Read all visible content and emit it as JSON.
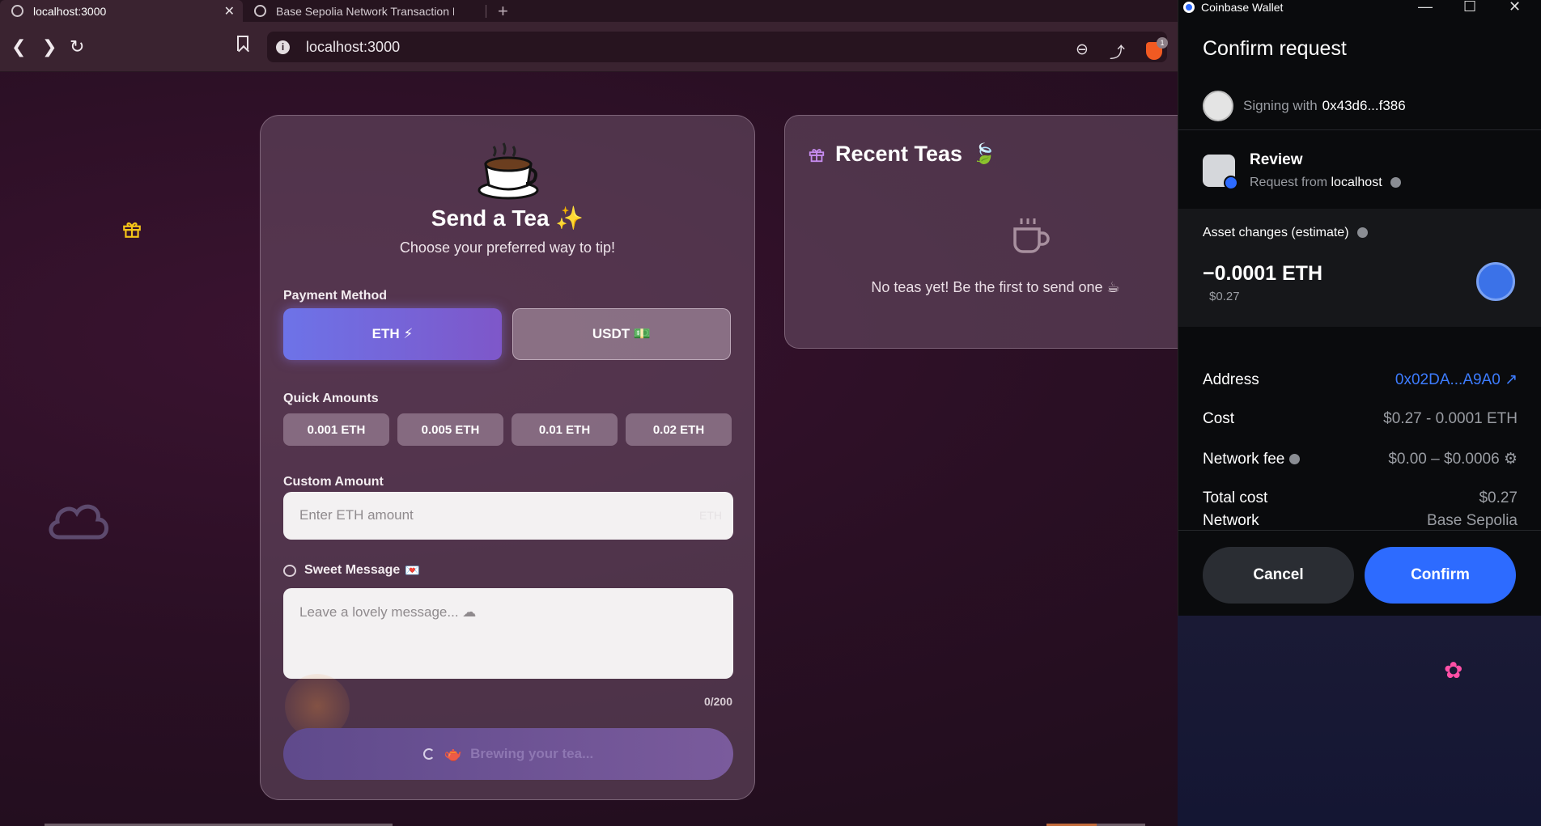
{
  "browser": {
    "tabs": [
      {
        "title": "localhost:3000",
        "close": "✕"
      },
      {
        "title": "Base Sepolia Network Transaction Ha"
      }
    ],
    "new_tab": "+",
    "url": "localhost:3000",
    "shields_count": "1"
  },
  "tea_card": {
    "title": "Send a Tea ✨",
    "subtitle": "Choose your preferred way to tip!",
    "payment_method_label": "Payment Method",
    "payment_options": [
      "ETH ⚡",
      "USDT 💵"
    ],
    "quick_amounts_label": "Quick Amounts",
    "quick_amounts": [
      "0.001 ETH",
      "0.005 ETH",
      "0.01 ETH",
      "0.02 ETH"
    ],
    "custom_amount_label": "Custom Amount",
    "custom_amount_placeholder": "Enter ETH amount",
    "custom_amount_unit": "ETH",
    "message_label": "Sweet Message",
    "message_label_emoji": "💌",
    "message_placeholder": "Leave a lovely message... ☁",
    "char_count": "0/200",
    "submit_label": "Brewing your tea...",
    "submit_emoji": "🫖"
  },
  "recent_card": {
    "title": "Recent Teas",
    "title_emoji": "🍃",
    "empty_text": "No teas yet! Be the first to send one ☕"
  },
  "wallet": {
    "window_title": "Coinbase Wallet",
    "header": "Confirm request",
    "signing_label": "Signing with",
    "signing_address": "0x43d6...f386",
    "review_title": "Review",
    "review_sub_prefix": "Request from",
    "review_origin": "localhost",
    "asset_changes_label": "Asset changes (estimate)",
    "asset_amount": "−0.0001 ETH",
    "asset_usd": "$0.27",
    "details": [
      {
        "key": "Address",
        "value": "0x02DA...A9A0 ↗"
      },
      {
        "key": "Cost",
        "value": "$0.27 - 0.0001 ETH"
      },
      {
        "key": "Network fee",
        "value": "$0.00 – $0.0006 ⚙"
      },
      {
        "key": "Total cost",
        "value": "$0.27"
      },
      {
        "key": "Network",
        "value": "Base Sepolia"
      }
    ],
    "cancel_label": "Cancel",
    "confirm_label": "Confirm"
  },
  "colors": {
    "accent_blue": "#2d6bff",
    "eth_gradient_start": "#6d73e8",
    "eth_gradient_end": "#7e57c9",
    "flower_pink": "#ff4fa6",
    "gift_yellow": "#f5c518"
  },
  "icons": [
    "globe-icon",
    "back-icon",
    "forward-icon",
    "reload-icon",
    "bookmark-icon",
    "zoom-icon",
    "share-icon",
    "brave-shield-icon",
    "gift-icon",
    "cloud-icon",
    "flower-icon",
    "tea-cup-icon",
    "coffee-mug-icon",
    "ethereum-icon"
  ]
}
